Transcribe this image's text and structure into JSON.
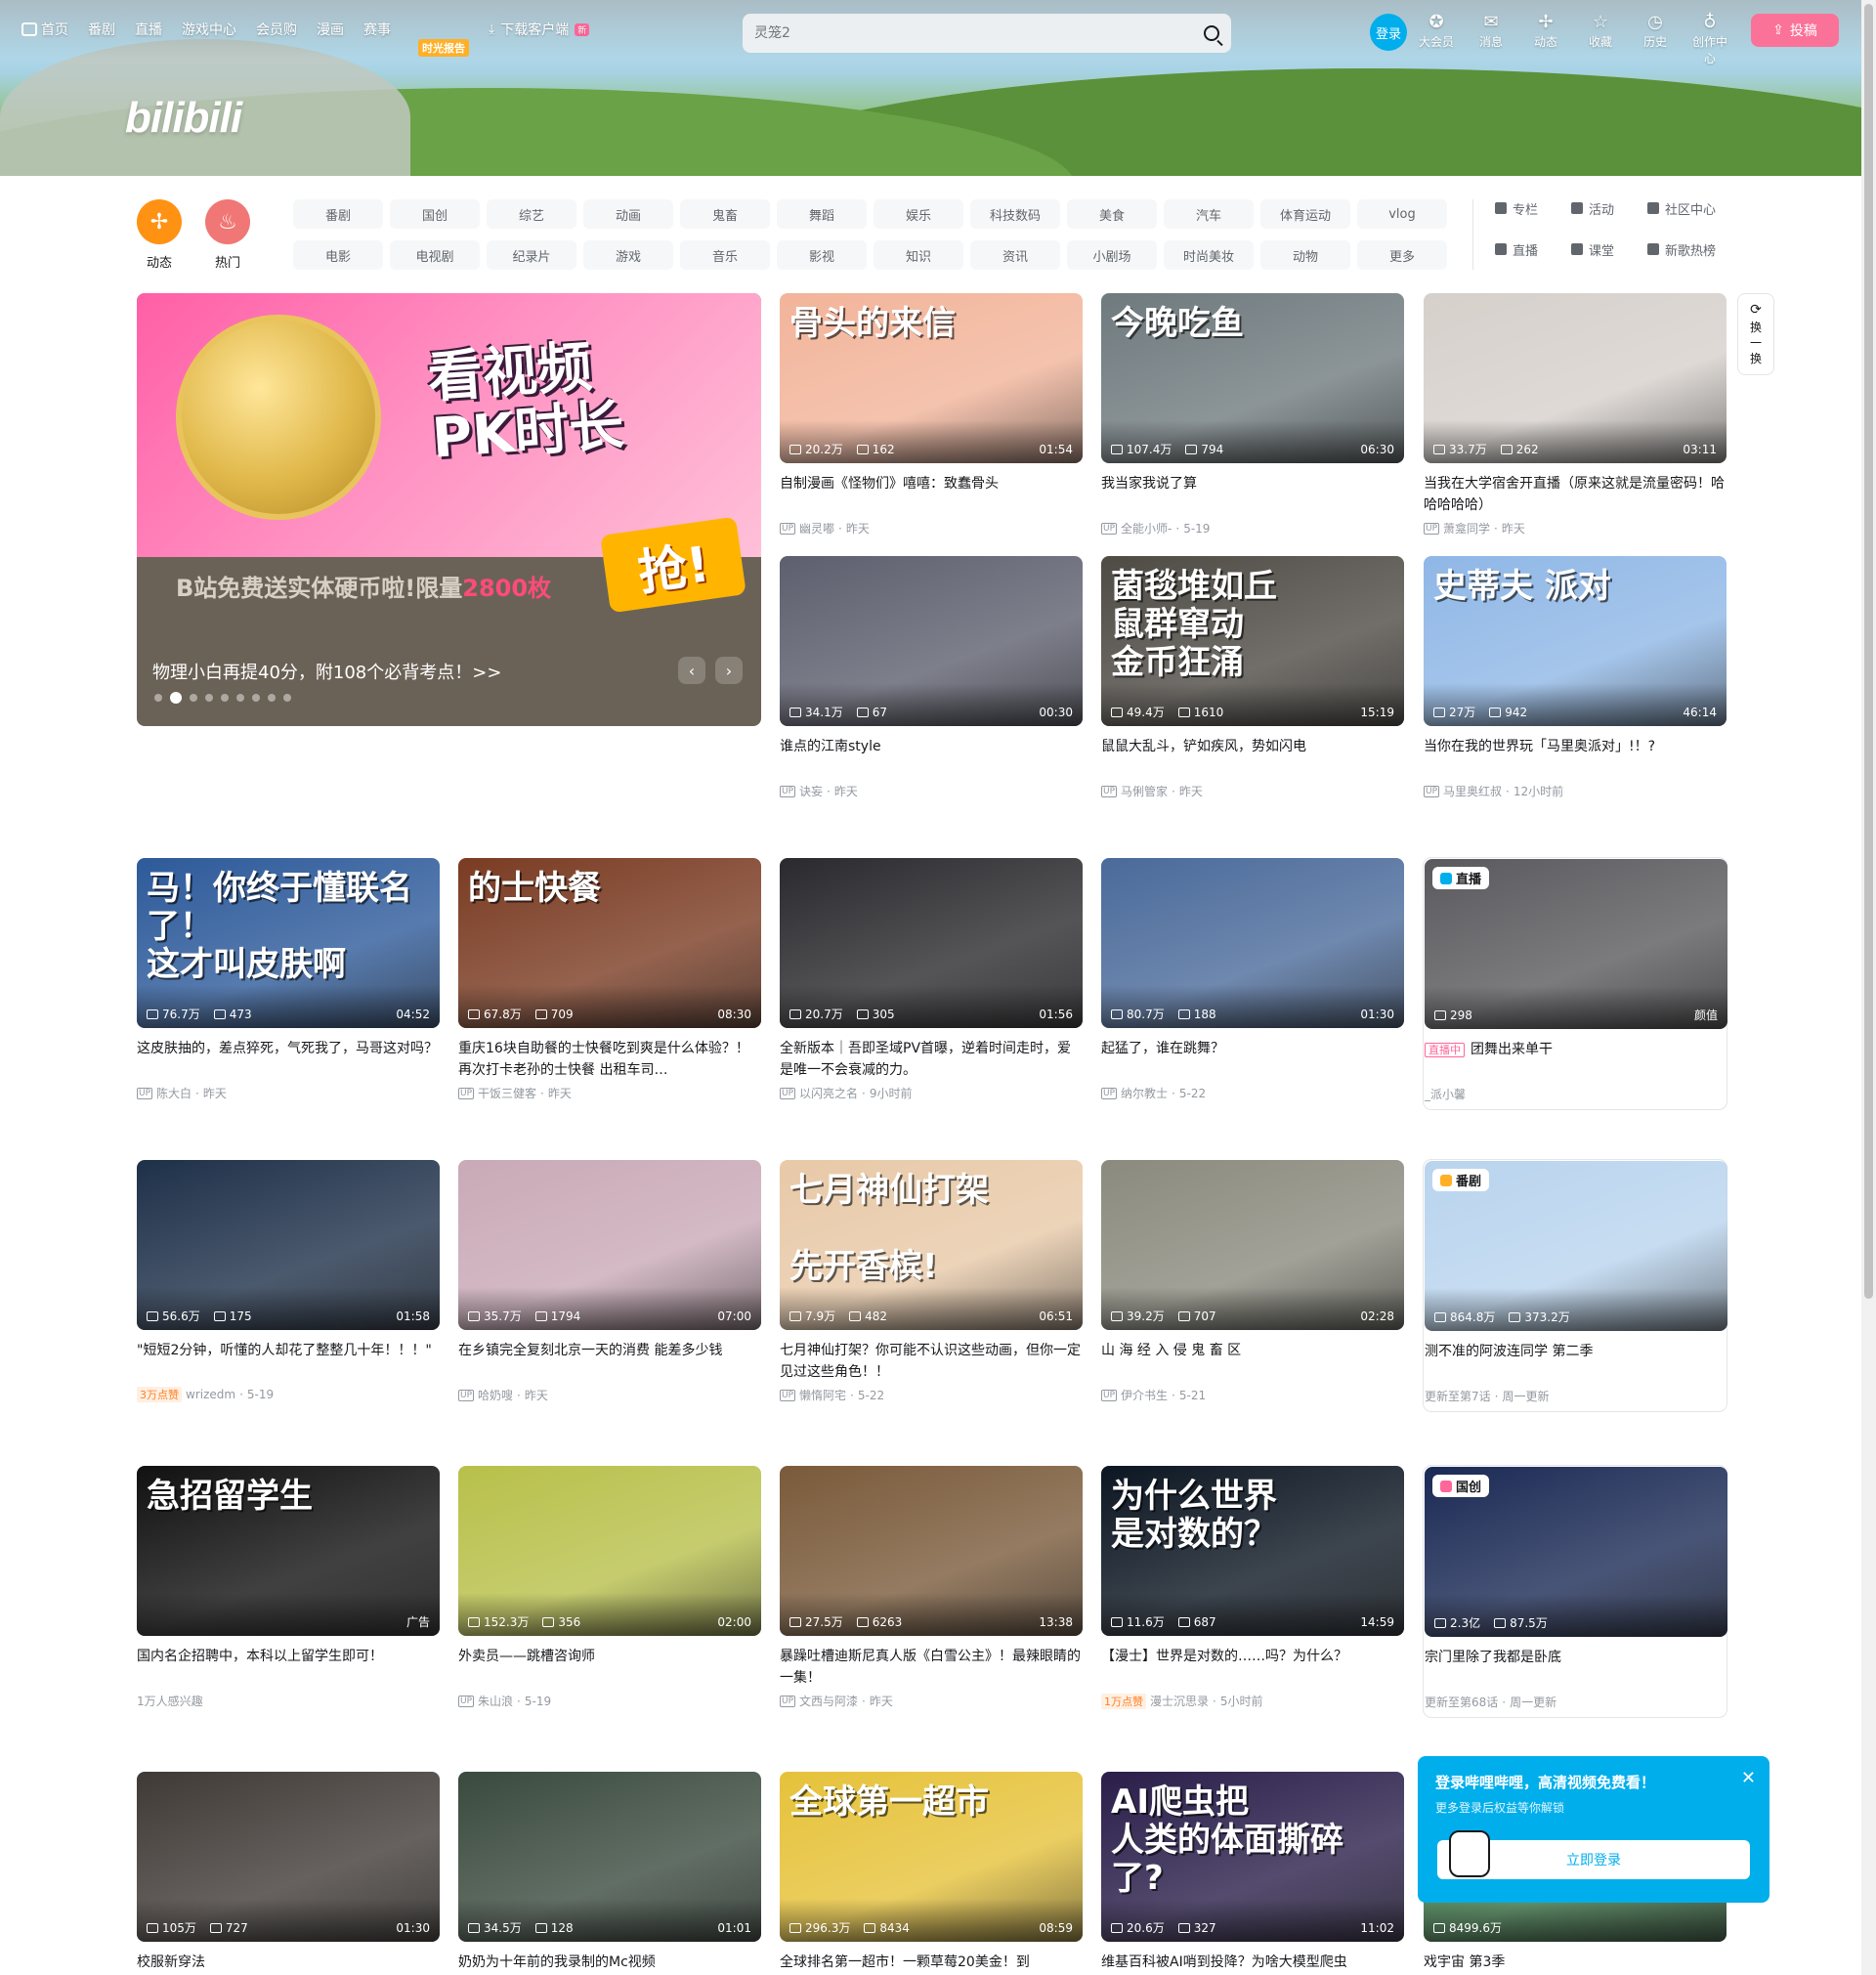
{
  "header": {
    "nav": [
      {
        "label": "首页",
        "icon": "tv-icon"
      },
      {
        "label": "番剧"
      },
      {
        "label": "直播"
      },
      {
        "label": "游戏中心"
      },
      {
        "label": "会员购"
      },
      {
        "label": "漫画"
      },
      {
        "label": "赛事"
      }
    ],
    "promo_tag": "时光报告",
    "download_label": "下载客户端",
    "download_badge": "新",
    "logo_text": "bilibili",
    "search": {
      "placeholder": "灵笼2"
    },
    "login_label": "登录",
    "right_nav": [
      {
        "label": "大会员",
        "icon": "vip-icon"
      },
      {
        "label": "消息",
        "icon": "message-icon"
      },
      {
        "label": "动态",
        "icon": "dynamic-icon"
      },
      {
        "label": "收藏",
        "icon": "star-icon"
      },
      {
        "label": "历史",
        "icon": "history-icon"
      },
      {
        "label": "创作中心",
        "icon": "bulb-icon"
      }
    ],
    "upload_label": "投稿"
  },
  "channels": {
    "circles": [
      {
        "label": "动态",
        "color": "#ff9212",
        "icon": "pinwheel-icon"
      },
      {
        "label": "热门",
        "color": "#f07775",
        "icon": "flame-icon"
      }
    ],
    "chips": [
      "番剧",
      "国创",
      "综艺",
      "动画",
      "鬼畜",
      "舞蹈",
      "娱乐",
      "科技数码",
      "美食",
      "汽车",
      "体育运动",
      "vlog",
      "电影",
      "电视剧",
      "纪录片",
      "游戏",
      "音乐",
      "影视",
      "知识",
      "资讯",
      "小剧场",
      "时尚美妆",
      "动物",
      "更多"
    ],
    "side_links": [
      {
        "label": "专栏",
        "icon": "article-icon"
      },
      {
        "label": "活动",
        "icon": "flag-icon"
      },
      {
        "label": "社区中心",
        "icon": "community-icon"
      },
      {
        "label": "直播",
        "icon": "live-icon"
      },
      {
        "label": "课堂",
        "icon": "class-icon"
      },
      {
        "label": "新歌热榜",
        "icon": "music-icon"
      }
    ]
  },
  "carousel": {
    "headline": "看视频\nPK时长",
    "subline_pre": "B站免费送实体硬币啦!限量",
    "subline_num": "2800枚",
    "grab": "抢!",
    "caption": "物理小白再提40分，附108个必背考点！>>",
    "dots": 9,
    "active_dot": 1
  },
  "refresh_label": "换一换",
  "videos": [
    {
      "title": "自制漫画《怪物们》嘻嘻：致蠢骨头",
      "views": "20.2万",
      "danmaku": "162",
      "duration": "01:54",
      "author": "幽灵嘟",
      "date": "昨天",
      "thumb_text": "骨头的来信",
      "color": "#f2b49a"
    },
    {
      "title": "我当家我说了算",
      "views": "107.4万",
      "danmaku": "794",
      "duration": "06:30",
      "author": "全能小师-",
      "date": "5-19",
      "thumb_text": "今晚吃鱼",
      "color": "#6f7a7e"
    },
    {
      "title": "当我在大学宿舍开直播（原来这就是流量密码！哈哈哈哈哈）",
      "views": "33.7万",
      "danmaku": "262",
      "duration": "03:11",
      "author": "萧龛同学",
      "date": "昨天",
      "thumb_text": "",
      "color": "#d6d0cb"
    },
    {
      "title": "谁点的江南style",
      "views": "34.1万",
      "danmaku": "67",
      "duration": "00:30",
      "author": "诀妄",
      "date": "昨天",
      "thumb_text": "",
      "color": "#5d5f6e"
    },
    {
      "title": "鼠鼠大乱斗，铲如疾风，势如闪电",
      "views": "49.4万",
      "danmaku": "1610",
      "duration": "15:19",
      "author": "马俐管家",
      "date": "昨天",
      "thumb_text": "菌毯堆如丘\n鼠群窜动\n金币狂涌",
      "color": "#4e4a44"
    },
    {
      "title": "当你在我的世界玩「马里奥派对」!！?",
      "views": "27万",
      "danmaku": "942",
      "duration": "46:14",
      "author": "马里奥红叔",
      "date": "12小时前",
      "thumb_text": "史蒂夫 派对",
      "color": "#8fb7e6"
    },
    {
      "title": "这皮肤抽的，差点猝死，气死我了，马哥这对吗？",
      "views": "76.7万",
      "danmaku": "473",
      "duration": "04:52",
      "author": "陈大白",
      "date": "昨天",
      "thumb_text": "马！你终于懂联名了！\n这才叫皮肤啊",
      "color": "#2d5a9a"
    },
    {
      "title": "重庆16块自助餐的士快餐吃到爽是什么体验？！再次打卡老孙的士快餐 出租车司…",
      "views": "67.8万",
      "danmaku": "709",
      "duration": "08:30",
      "author": "干饭三健客",
      "date": "昨天",
      "thumb_text": "的士快餐",
      "color": "#7a3b22"
    },
    {
      "title": "全新版本｜吾即圣域PV首曝，逆着时间走时，爱是唯一不会衰减的力。",
      "views": "20.7万",
      "danmaku": "305",
      "duration": "01:56",
      "author": "以闪亮之名",
      "date": "9小时前",
      "thumb_text": "",
      "color": "#2a2a2e"
    },
    {
      "title": "起猛了，谁在跳舞？",
      "views": "80.7万",
      "danmaku": "188",
      "duration": "01:30",
      "author": "纳尔教士",
      "date": "5-22",
      "thumb_text": "",
      "color": "#4a6a9a"
    },
    {
      "title": "团舞出来单干",
      "views": "298",
      "danmaku": "",
      "duration": "颜值",
      "author": "_派小馨",
      "date": "",
      "thumb_text": "",
      "color": "#5a5a5e",
      "badge": "直播",
      "live": "直播中"
    },
    {
      "title": "\"短短2分钟，听懂的人却花了整整几十年！！！\"",
      "views": "56.6万",
      "danmaku": "175",
      "duration": "01:58",
      "author": "wrizedm",
      "date": "5-19",
      "thumb_text": "",
      "color": "#1e3049",
      "hot": "3万点赞"
    },
    {
      "title": "在乡镇完全复刻北京一天的消费 能差多少钱",
      "views": "35.7万",
      "danmaku": "1794",
      "duration": "07:00",
      "author": "哈奶嗖",
      "date": "昨天",
      "thumb_text": "",
      "color": "#c9a9b6"
    },
    {
      "title": "七月神仙打架？你可能不认识这些动画，但你一定见过这些角色！！",
      "views": "7.9万",
      "danmaku": "482",
      "duration": "06:51",
      "author": "懒惰阿宅",
      "date": "5-22",
      "thumb_text": "七月神仙打架\n\n先开香槟!",
      "color": "#e8c9a8"
    },
    {
      "title": "山 海 经 入 侵 鬼 畜 区",
      "views": "39.2万",
      "danmaku": "707",
      "duration": "02:28",
      "author": "伊介书生",
      "date": "5-21",
      "thumb_text": "",
      "color": "#8a8a7e"
    },
    {
      "title": "测不准的阿波连同学 第二季",
      "views": "864.8万",
      "danmaku": "373.2万",
      "duration": "",
      "author": "更新至第7话",
      "date": "周一更新",
      "thumb_text": "",
      "color": "#b9d4ee",
      "badge": "番剧"
    },
    {
      "title": "国内名企招聘中，本科以上留学生即可！",
      "views": "",
      "danmaku": "",
      "duration": "广告",
      "author": "1万人感兴趣",
      "date": "",
      "thumb_text": "急招留学生",
      "color": "#111111",
      "ad": "1"
    },
    {
      "title": "外卖员——跳槽咨询师",
      "views": "152.3万",
      "danmaku": "356",
      "duration": "02:00",
      "author": "朱山浪",
      "date": "5-19",
      "thumb_text": "",
      "color": "#b8c04a"
    },
    {
      "title": "暴躁吐槽迪斯尼真人版《白雪公主》！最辣眼睛的一集！",
      "views": "27.5万",
      "danmaku": "6263",
      "duration": "13:38",
      "author": "文西与阿漆",
      "date": "昨天",
      "thumb_text": "",
      "color": "#7a5a3a"
    },
    {
      "title": "【漫士】世界是对数的……吗？为什么？",
      "views": "11.6万",
      "danmaku": "687",
      "duration": "14:59",
      "author": "漫士沉思录",
      "date": "5小时前",
      "thumb_text": "为什么世界\n是对数的？",
      "color": "#0c1622",
      "hot": "1万点赞"
    },
    {
      "title": "宗门里除了我都是卧底",
      "views": "2.3亿",
      "danmaku": "87.5万",
      "duration": "",
      "author": "更新至第68话",
      "date": "周一更新",
      "thumb_text": "",
      "color": "#1b2a55",
      "badge": "国创"
    },
    {
      "title": "校服新穿法",
      "views": "105万",
      "danmaku": "727",
      "duration": "01:30",
      "author": "",
      "date": "",
      "thumb_text": "",
      "color": "#403a36"
    },
    {
      "title": "奶奶为十年前的我录制的Mc视频",
      "views": "34.5万",
      "danmaku": "128",
      "duration": "01:01",
      "author": "",
      "date": "",
      "thumb_text": "",
      "color": "#3a4a3e"
    },
    {
      "title": "全球排名第一超市！一颗草莓20美金！到",
      "views": "296.3万",
      "danmaku": "8434",
      "duration": "08:59",
      "author": "",
      "date": "",
      "thumb_text": "全球第一超市",
      "color": "#e6c23a"
    },
    {
      "title": "维基百科被AI哨到投降？为啥大模型爬虫",
      "views": "20.6万",
      "danmaku": "327",
      "duration": "11:02",
      "author": "",
      "date": "",
      "thumb_text": "AI爬虫把\n人类的体面撕碎了?",
      "color": "#2a1e4a"
    },
    {
      "title": "戏宇宙 第3季",
      "views": "8499.6万",
      "danmaku": "",
      "duration": "",
      "author": "",
      "date": "",
      "thumb_text": "",
      "color": "#3e7a4a"
    }
  ],
  "popup": {
    "title": "登录哔哩哔哩，高清视频免费看！",
    "subtitle": "更多登录后权益等你解锁",
    "button": "立即登录"
  }
}
